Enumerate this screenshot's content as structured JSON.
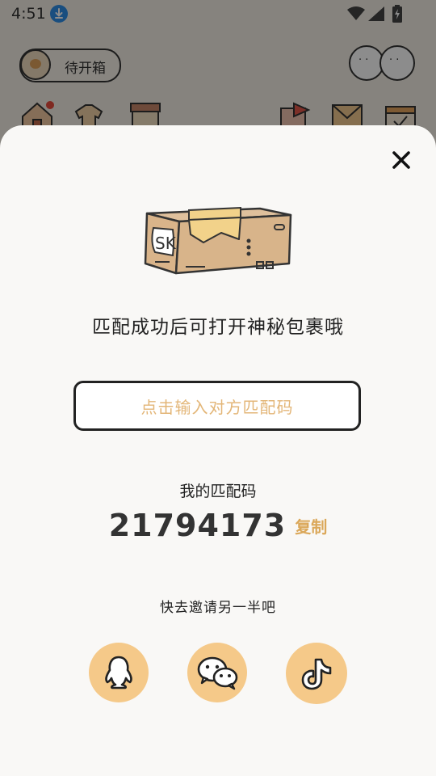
{
  "status_bar": {
    "time": "4:51"
  },
  "background": {
    "chip_label": "待开箱"
  },
  "sheet": {
    "hint": "匹配成功后可打开神秘包裹哦",
    "input": {
      "placeholder": "点击输入对方匹配码"
    },
    "my_code_label": "我的匹配码",
    "my_code": "21794173",
    "copy_label": "复制",
    "invite_text": "快去邀请另一半吧",
    "box_label": "SK"
  },
  "colors": {
    "accent": "#f5c989",
    "copy": "#dba85a",
    "placeholder": "#e3b678",
    "sheet_bg": "#f9f8f6"
  },
  "icons": [
    "download-icon",
    "wifi-icon",
    "signal-icon",
    "battery-icon",
    "close-icon",
    "qq-icon",
    "wechat-icon",
    "douyin-icon"
  ]
}
